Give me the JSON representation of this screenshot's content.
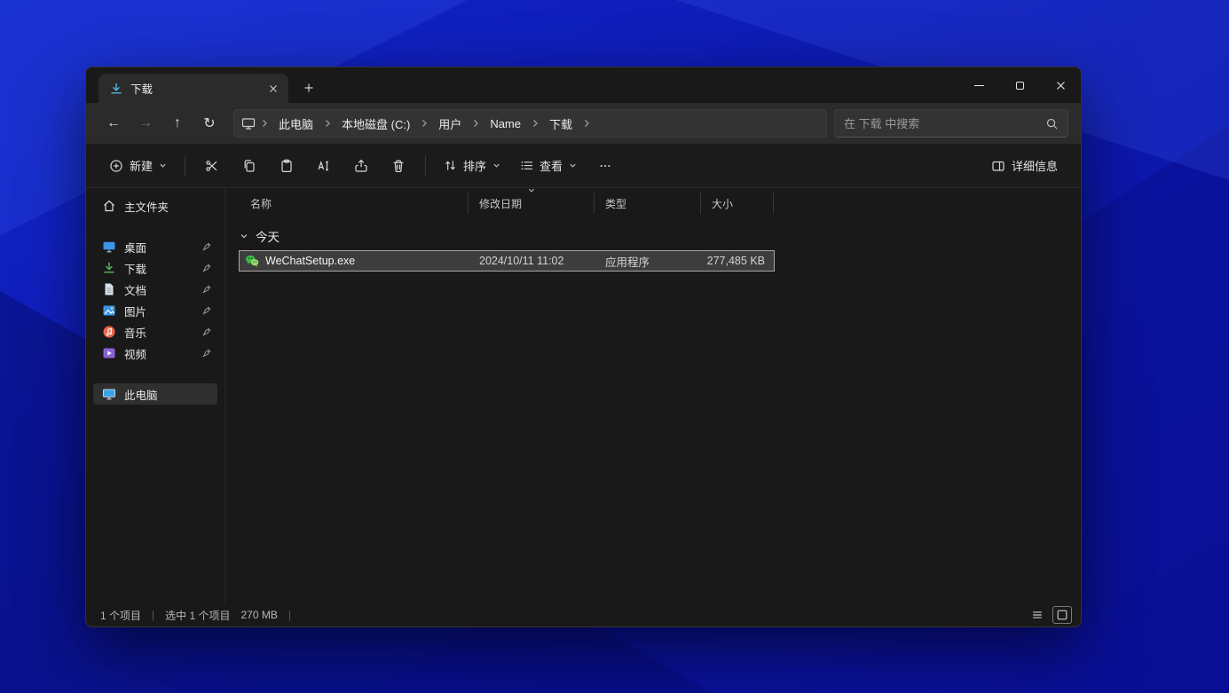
{
  "window": {
    "tab_title": "下载"
  },
  "addressbar": {
    "breadcrumbs": [
      "此电脑",
      "本地磁盘 (C:)",
      "用户",
      "Name",
      "下载"
    ],
    "search_placeholder": "在 下载 中搜索"
  },
  "icons": {
    "back": "←",
    "forward": "→",
    "up": "↑",
    "refresh": "↻"
  },
  "toolbar": {
    "new_label": "新建",
    "sort_label": "排序",
    "view_label": "查看",
    "details_label": "详细信息"
  },
  "sidebar": {
    "home_label": "主文件夹",
    "pinned": [
      {
        "label": "桌面"
      },
      {
        "label": "下载"
      },
      {
        "label": "文档"
      },
      {
        "label": "图片"
      },
      {
        "label": "音乐"
      },
      {
        "label": "视频"
      }
    ],
    "this_pc_label": "此电脑"
  },
  "main": {
    "columns": [
      "名称",
      "修改日期",
      "类型",
      "大小"
    ],
    "group_label": "今天",
    "files": [
      {
        "name": "WeChatSetup.exe",
        "modified": "2024/10/11 11:02",
        "type": "应用程序",
        "size": "277,485 KB"
      }
    ]
  },
  "statusbar": {
    "items": "1 个项目",
    "selected": "选中 1 个项目",
    "size": "270 MB"
  },
  "colors": {
    "wallpaper_blue": "#0c17ad",
    "window_bg": "#191919",
    "header_bg": "#2b2b2b",
    "selection_bg": "#3d3d3d",
    "selection_border": "#a6a6a6",
    "wechat_green": "#3eb84a",
    "downloads_green": "#53b15f",
    "accent_blue": "#3c96e8",
    "music_orange": "#e8684a",
    "video_purple": "#8a63d2"
  }
}
